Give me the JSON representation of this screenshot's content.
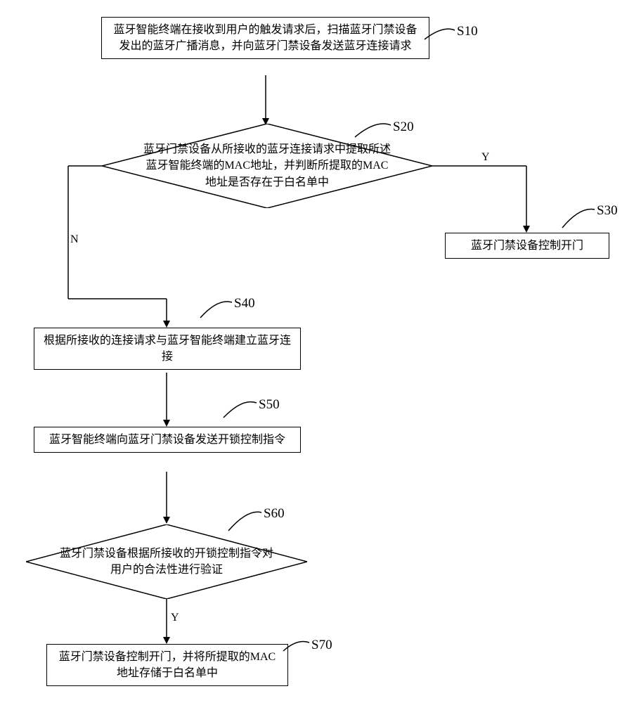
{
  "steps": {
    "s10": {
      "label": "S10",
      "text": "蓝牙智能终端在接收到用户的触发请求后，扫描蓝牙门禁设备发出的蓝牙广播消息，并向蓝牙门禁设备发送蓝牙连接请求"
    },
    "s20": {
      "label": "S20",
      "text": "蓝牙门禁设备从所接收的蓝牙连接请求中提取所述蓝牙智能终端的MAC地址，并判断所提取的MAC地址是否存在于白名单中"
    },
    "s30": {
      "label": "S30",
      "text": "蓝牙门禁设备控制开门"
    },
    "s40": {
      "label": "S40",
      "text": "根据所接收的连接请求与蓝牙智能终端建立蓝牙连接"
    },
    "s50": {
      "label": "S50",
      "text": "蓝牙智能终端向蓝牙门禁设备发送开锁控制指令"
    },
    "s60": {
      "label": "S60",
      "text": "蓝牙门禁设备根据所接收的开锁控制指令对用户的合法性进行验证"
    },
    "s70": {
      "label": "S70",
      "text": "蓝牙门禁设备控制开门，并将所提取的MAC地址存储于白名单中"
    }
  },
  "edges": {
    "y": "Y",
    "n": "N",
    "y2": "Y"
  }
}
